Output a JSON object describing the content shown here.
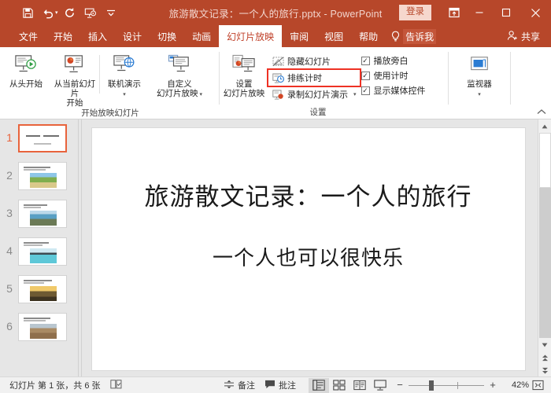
{
  "titlebar": {
    "document_title": "旅游散文记录：一个人的旅行.pptx  -  PowerPoint",
    "signin_label": "登录",
    "quick_access": [
      {
        "name": "save-icon",
        "label": "保存"
      },
      {
        "name": "undo-icon",
        "label": "撤消"
      },
      {
        "name": "redo-icon",
        "label": "重复"
      },
      {
        "name": "start-slideshow-icon",
        "label": "从头开始"
      },
      {
        "name": "customize-qat-icon",
        "label": "自定义快速访问工具栏"
      }
    ],
    "window_buttons": {
      "ribbon_display": "功能区显示选项",
      "minimize": "最小化",
      "maximize": "最大化",
      "close": "关闭"
    }
  },
  "tabs": [
    {
      "label": "文件",
      "active": false
    },
    {
      "label": "开始",
      "active": false
    },
    {
      "label": "插入",
      "active": false
    },
    {
      "label": "设计",
      "active": false
    },
    {
      "label": "切换",
      "active": false
    },
    {
      "label": "动画",
      "active": false
    },
    {
      "label": "幻灯片放映",
      "active": true
    },
    {
      "label": "审阅",
      "active": false
    },
    {
      "label": "视图",
      "active": false
    },
    {
      "label": "帮助",
      "active": false
    }
  ],
  "tellme_label": "告诉我",
  "share_label": "共享",
  "ribbon": {
    "groups": [
      {
        "label": "开始放映幻灯片",
        "buttons": [
          {
            "label_line1": "从头开始",
            "label_line2": "",
            "icon": "start-from-beginning-icon",
            "dropdown": false
          },
          {
            "label_line1": "从当前幻灯片",
            "label_line2": "开始",
            "icon": "start-from-current-icon",
            "dropdown": false
          },
          {
            "label_line1": "联机演示",
            "label_line2": "",
            "icon": "present-online-icon",
            "dropdown": true
          },
          {
            "label_line1": "自定义",
            "label_line2": "幻灯片放映",
            "icon": "custom-slideshow-icon",
            "dropdown": true
          }
        ]
      },
      {
        "label": "设置",
        "setup_button": {
          "label_line1": "设置",
          "label_line2": "幻灯片放映",
          "icon": "setup-slideshow-icon"
        },
        "small_buttons": [
          {
            "label": "隐藏幻灯片",
            "icon": "hide-slide-icon",
            "dropdown": false,
            "highlighted": false
          },
          {
            "label": "排练计时",
            "icon": "rehearse-timings-icon",
            "dropdown": false,
            "highlighted": true
          },
          {
            "label": "录制幻灯片演示",
            "icon": "record-slideshow-icon",
            "dropdown": true,
            "highlighted": false
          }
        ],
        "checkboxes": [
          {
            "label": "播放旁白",
            "checked": true
          },
          {
            "label": "使用计时",
            "checked": true
          },
          {
            "label": "显示媒体控件",
            "checked": true
          }
        ]
      },
      {
        "label": "",
        "buttons": [
          {
            "label_line1": "监视器",
            "label_line2": "",
            "icon": "monitor-icon",
            "dropdown": true
          }
        ]
      }
    ],
    "collapse_label": "折叠功能区"
  },
  "thumbnails": [
    {
      "number": "1",
      "selected": true,
      "image_tone": "none"
    },
    {
      "number": "2",
      "selected": false,
      "image_tone": "green-field"
    },
    {
      "number": "3",
      "selected": false,
      "image_tone": "blue-coast"
    },
    {
      "number": "4",
      "selected": false,
      "image_tone": "turquoise-sea"
    },
    {
      "number": "5",
      "selected": false,
      "image_tone": "golden-sunset"
    },
    {
      "number": "6",
      "selected": false,
      "image_tone": "desert-sand"
    }
  ],
  "slide": {
    "title": "旅游散文记录：一个人的旅行",
    "subtitle": "一个人也可以很快乐"
  },
  "statusbar": {
    "slide_counter": "幻灯片 第 1 张，共 6 张",
    "accessibility_icon_label": "辅助功能检查器",
    "notes_label": "备注",
    "comments_label": "批注",
    "views": [
      {
        "name": "normal-view",
        "label": "普通视图",
        "active": true
      },
      {
        "name": "slide-sorter-view",
        "label": "幻灯片浏览",
        "active": false
      },
      {
        "name": "reading-view",
        "label": "阅读视图",
        "active": false
      },
      {
        "name": "slideshow-view",
        "label": "幻灯片放映",
        "active": false
      }
    ],
    "zoom_out_label": "缩小",
    "zoom_in_label": "放大",
    "zoom_percent": "42%",
    "fit_label": "使幻灯片适应当前窗口"
  },
  "colors": {
    "brand": "#b7472a",
    "accent_highlight": "#ee3124",
    "selection": "#e8633c",
    "canvas": "#e6e6e6"
  }
}
